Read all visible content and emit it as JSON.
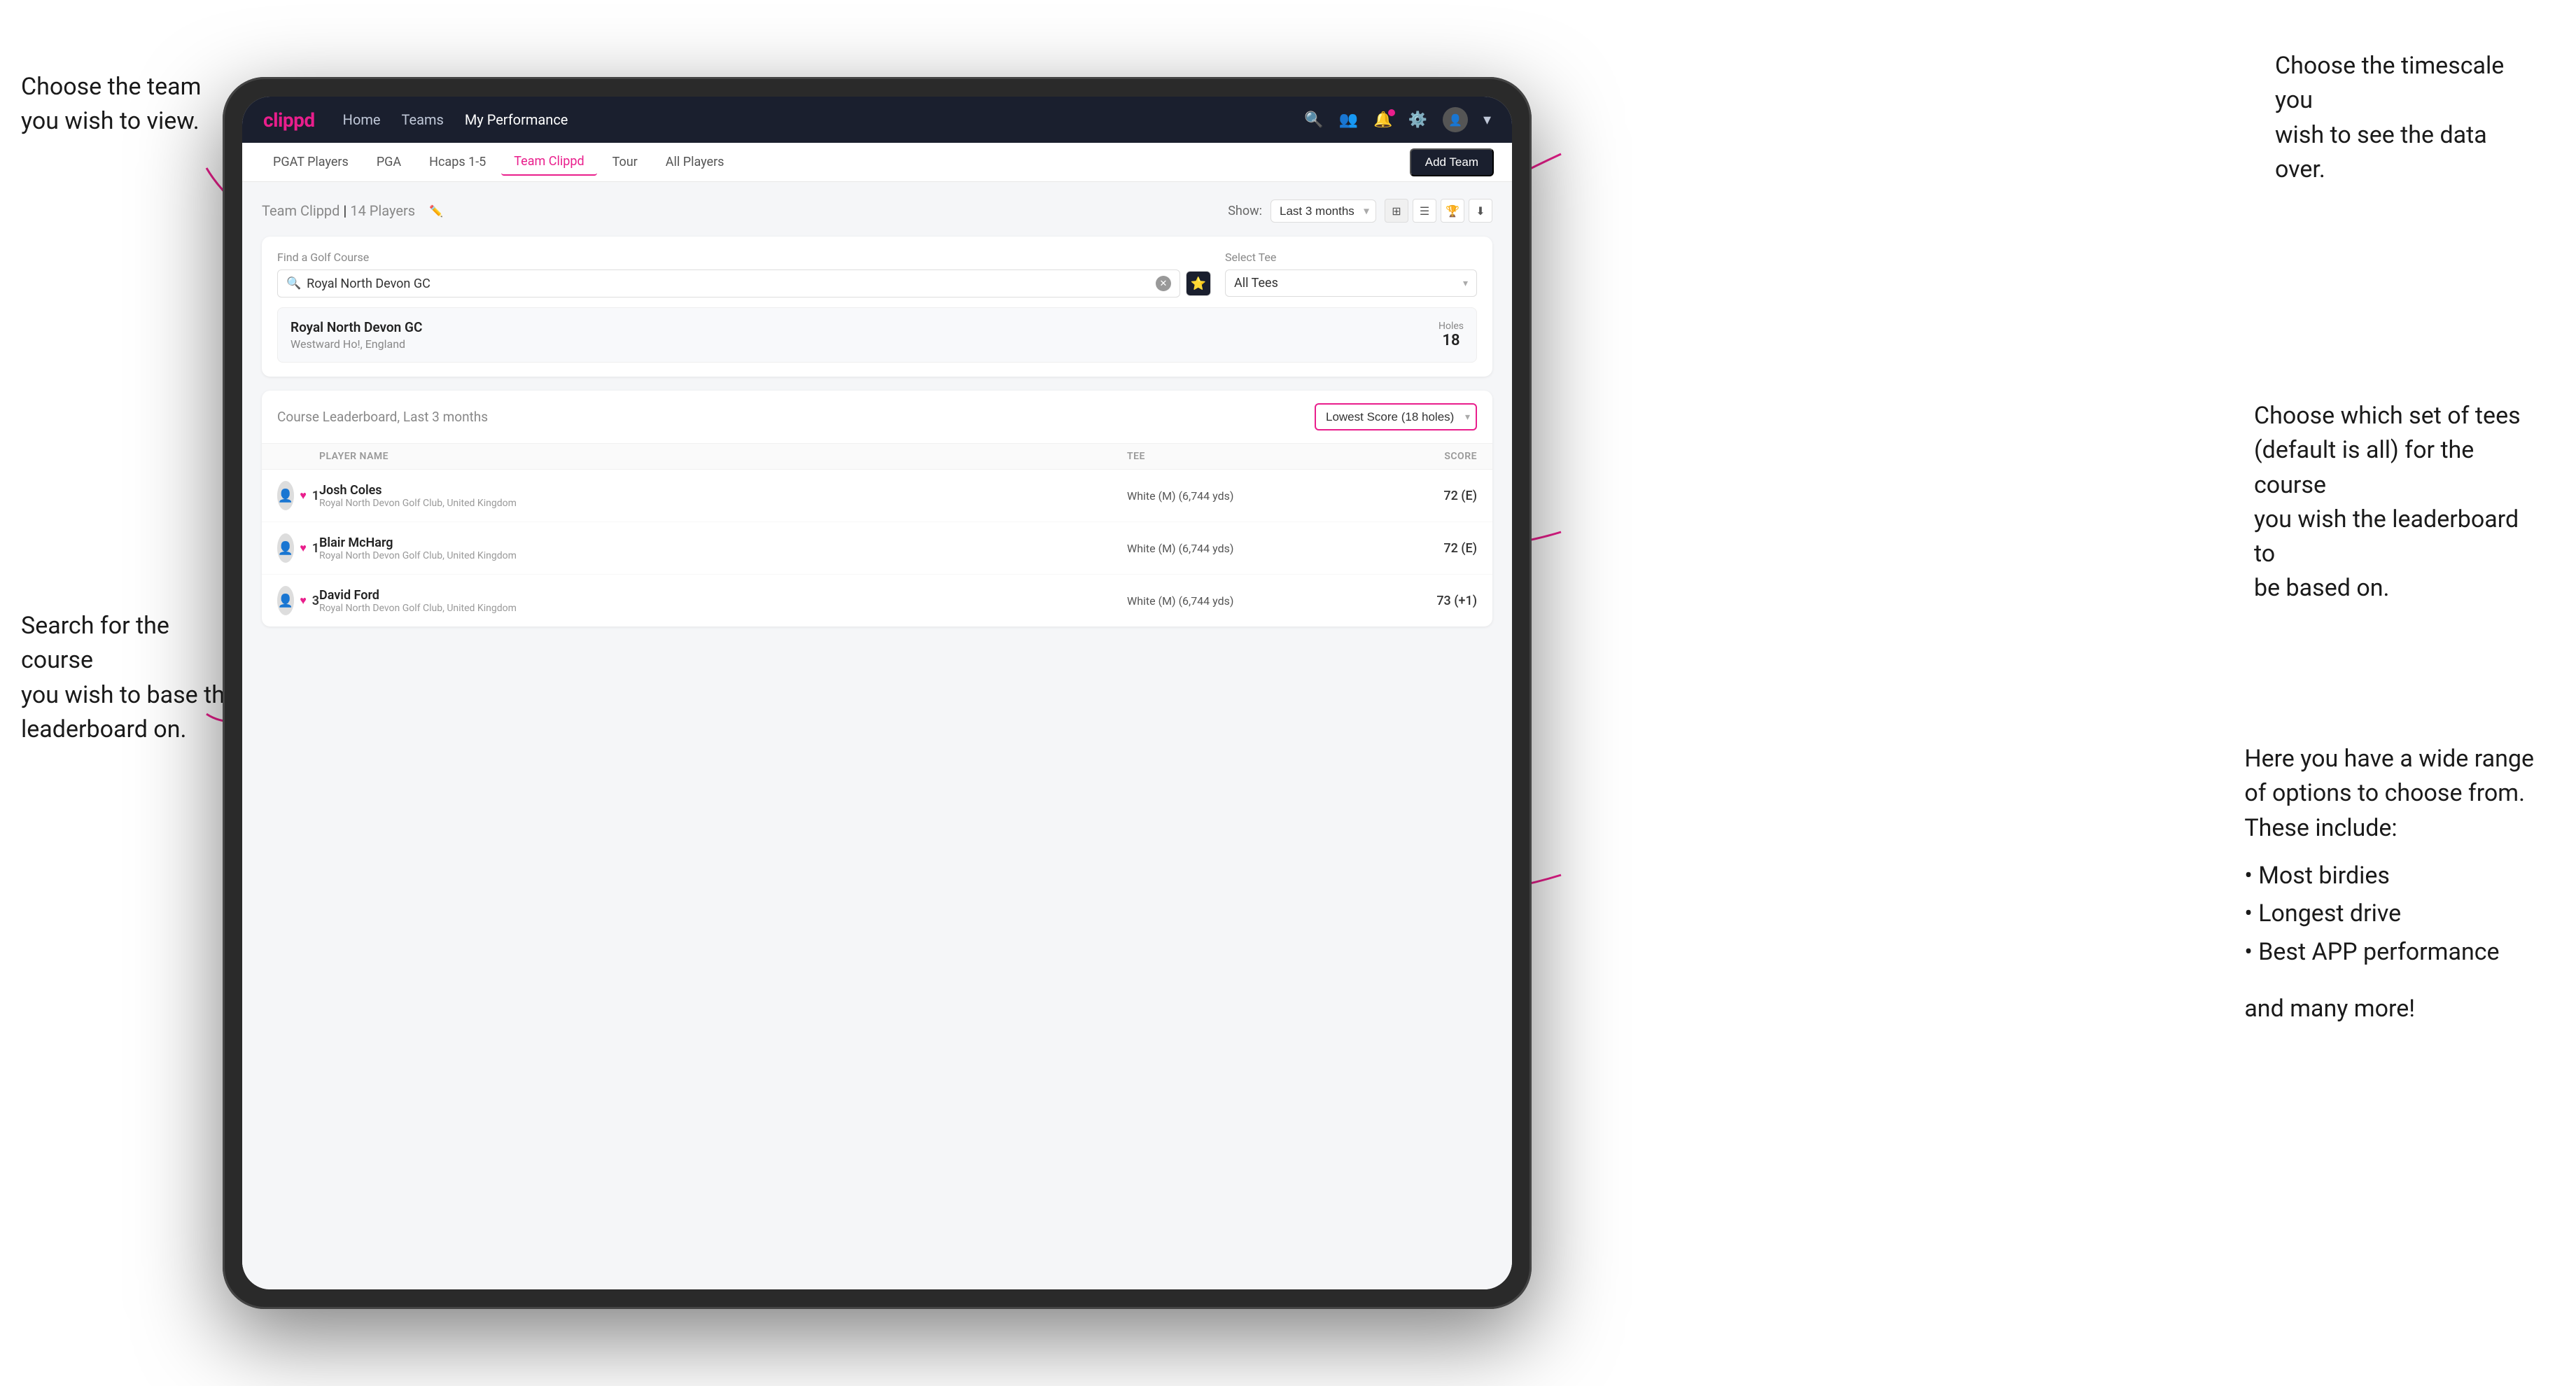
{
  "app": {
    "logo": "clippd",
    "nav": {
      "links": [
        "Home",
        "Teams",
        "My Performance"
      ],
      "active_link": "My Performance"
    },
    "sub_nav": {
      "tabs": [
        "PGAT Players",
        "PGA",
        "Hcaps 1-5",
        "Team Clippd",
        "Tour",
        "All Players"
      ],
      "active_tab": "Team Clippd",
      "add_team_label": "Add Team"
    }
  },
  "team_section": {
    "title": "Team Clippd",
    "player_count": "14 Players",
    "show_label": "Show:",
    "period": "Last 3 months"
  },
  "search_section": {
    "find_label": "Find a Golf Course",
    "search_value": "Royal North Devon GC",
    "tee_label": "Select Tee",
    "tee_value": "All Tees"
  },
  "course_result": {
    "name": "Royal North Devon GC",
    "location": "Westward Ho!, England",
    "holes_label": "Holes",
    "holes": "18"
  },
  "leaderboard": {
    "title": "Course Leaderboard,",
    "period": "Last 3 months",
    "score_type": "Lowest Score (18 holes)",
    "columns": [
      "PLAYER NAME",
      "TEE",
      "SCORE"
    ],
    "rows": [
      {
        "rank": "1",
        "name": "Josh Coles",
        "club": "Royal North Devon Golf Club, United Kingdom",
        "tee": "White (M) (6,744 yds)",
        "score": "72 (E)"
      },
      {
        "rank": "1",
        "name": "Blair McHarg",
        "club": "Royal North Devon Golf Club, United Kingdom",
        "tee": "White (M) (6,744 yds)",
        "score": "72 (E)"
      },
      {
        "rank": "3",
        "name": "David Ford",
        "club": "Royal North Devon Golf Club, United Kingdom",
        "tee": "White (M) (6,744 yds)",
        "score": "73 (+1)"
      }
    ]
  },
  "annotations": {
    "top_left": "Choose the team you\nwish to view.",
    "bottom_left": "Search for the course\nyou wish to base the\nleaderboard on.",
    "top_right": "Choose the timescale you\nwish to see the data over.",
    "mid_right": "Choose which set of tees\n(default is all) for the course\nyou wish the leaderboard to\nbe based on.",
    "bottom_right_intro": "Here you have a wide range\nof options to choose from.\nThese include:",
    "options": [
      "Most birdies",
      "Longest drive",
      "Best APP performance"
    ],
    "and_more": "and many more!"
  },
  "colors": {
    "brand_pink": "#e91e8c",
    "nav_bg": "#1a1f2e",
    "arrow_color": "#e91e8c"
  }
}
